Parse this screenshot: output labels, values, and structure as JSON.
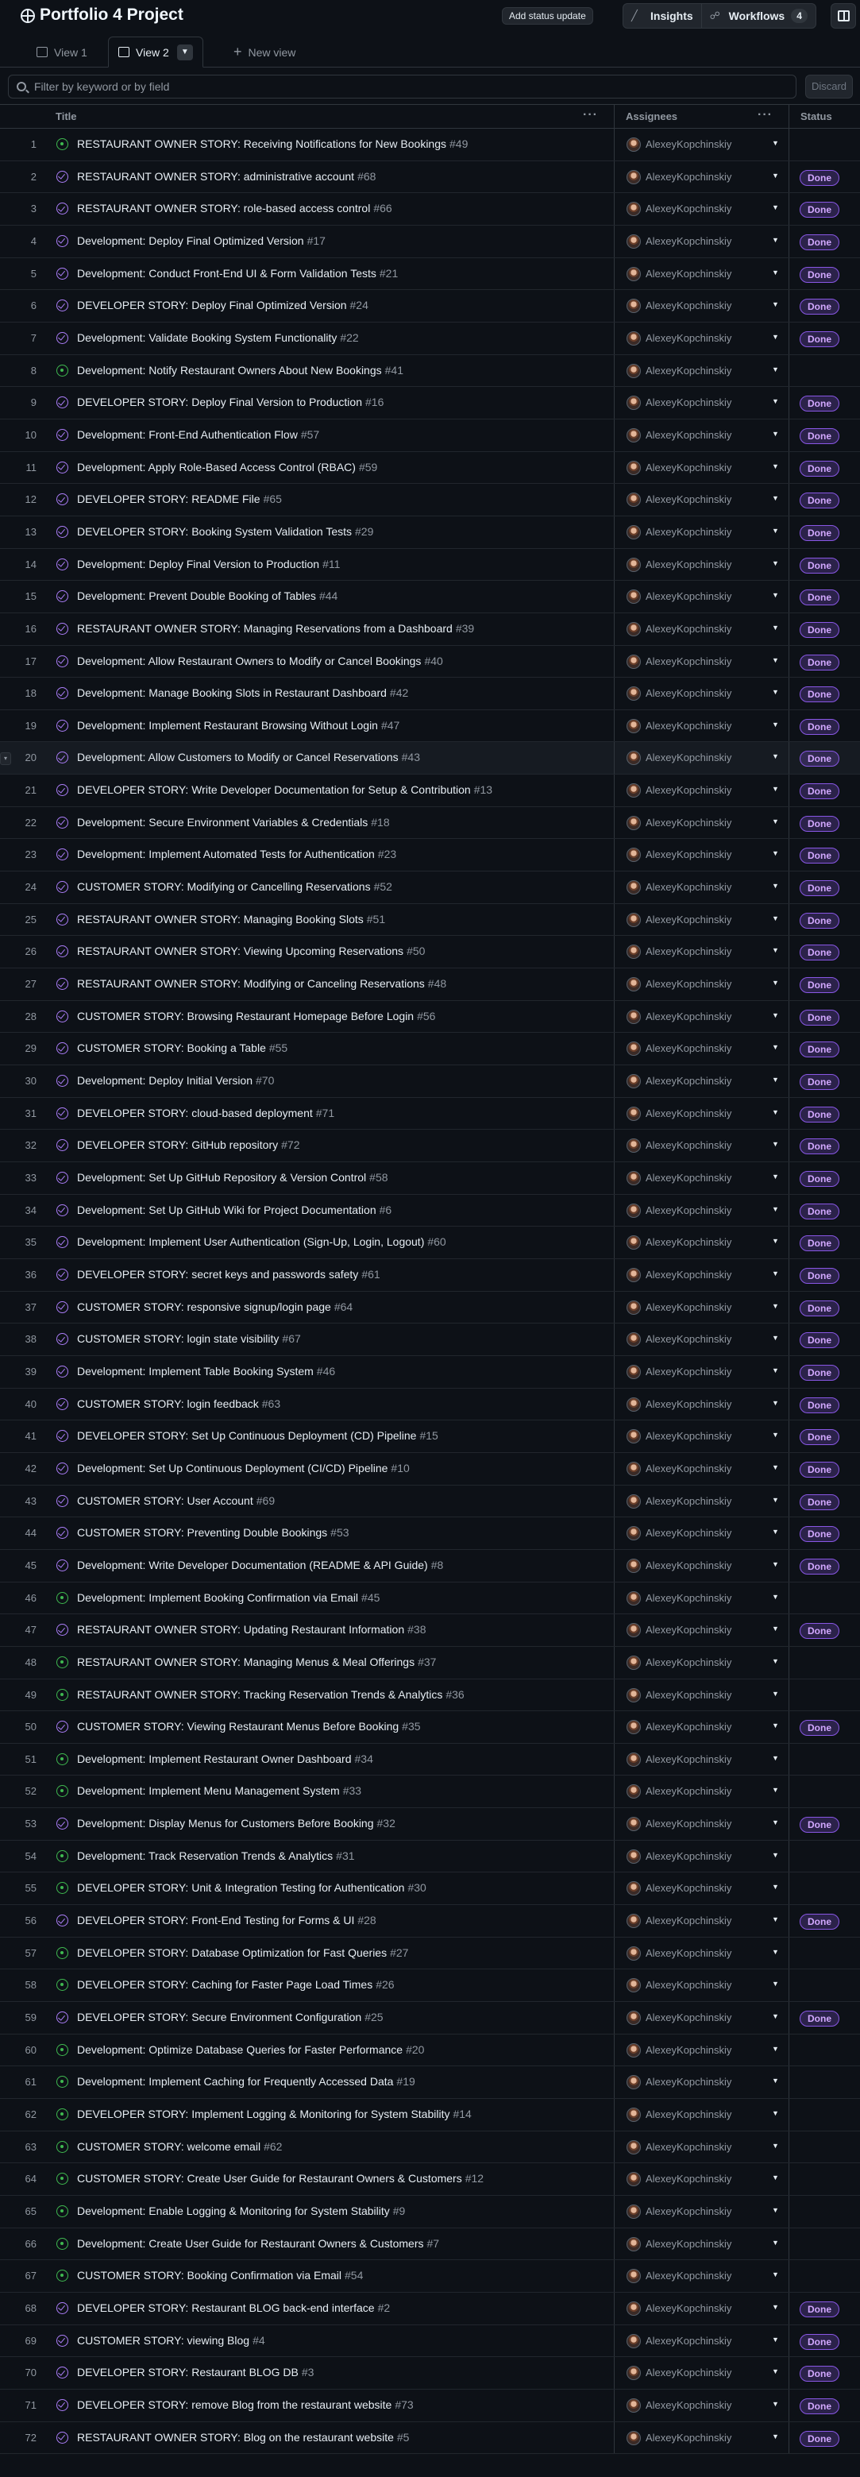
{
  "project": {
    "title": "Portfolio 4 Project"
  },
  "header": {
    "status_update_label": "Add status update",
    "insights_label": "Insights",
    "workflows_label": "Workflows",
    "workflows_count": "4"
  },
  "tabs": [
    {
      "label": "View 1"
    },
    {
      "label": "View 2"
    },
    {
      "label": "New view"
    }
  ],
  "filter": {
    "placeholder": "Filter by keyword or by field",
    "discard_label": "Discard"
  },
  "columns": {
    "title": "Title",
    "assignees": "Assignees",
    "status": "Status"
  },
  "rows": [
    {
      "n": "1",
      "state": "open",
      "title": "RESTAURANT OWNER STORY: Receiving Notifications for New Bookings",
      "num": "#49",
      "user": "AlexeyKopchinskiy",
      "status": ""
    },
    {
      "n": "2",
      "state": "closed",
      "title": "RESTAURANT OWNER STORY: administrative account",
      "num": "#68",
      "user": "AlexeyKopchinskiy",
      "status": "Done"
    },
    {
      "n": "3",
      "state": "closed",
      "title": "RESTAURANT OWNER STORY: role-based access control",
      "num": "#66",
      "user": "AlexeyKopchinskiy",
      "status": "Done"
    },
    {
      "n": "4",
      "state": "closed",
      "title": "Development: Deploy Final Optimized Version",
      "num": "#17",
      "user": "AlexeyKopchinskiy",
      "status": "Done"
    },
    {
      "n": "5",
      "state": "closed",
      "title": "Development: Conduct Front-End UI & Form Validation Tests",
      "num": "#21",
      "user": "AlexeyKopchinskiy",
      "status": "Done"
    },
    {
      "n": "6",
      "state": "closed",
      "title": "DEVELOPER STORY: Deploy Final Optimized Version",
      "num": "#24",
      "user": "AlexeyKopchinskiy",
      "status": "Done"
    },
    {
      "n": "7",
      "state": "closed",
      "title": "Development: Validate Booking System Functionality",
      "num": "#22",
      "user": "AlexeyKopchinskiy",
      "status": "Done"
    },
    {
      "n": "8",
      "state": "open",
      "title": "Development: Notify Restaurant Owners About New Bookings",
      "num": "#41",
      "user": "AlexeyKopchinskiy",
      "status": ""
    },
    {
      "n": "9",
      "state": "closed",
      "title": "DEVELOPER STORY: Deploy Final Version to Production",
      "num": "#16",
      "user": "AlexeyKopchinskiy",
      "status": "Done"
    },
    {
      "n": "10",
      "state": "closed",
      "title": "Development: Front-End Authentication Flow",
      "num": "#57",
      "user": "AlexeyKopchinskiy",
      "status": "Done"
    },
    {
      "n": "11",
      "state": "closed",
      "title": "Development: Apply Role-Based Access Control (RBAC)",
      "num": "#59",
      "user": "AlexeyKopchinskiy",
      "status": "Done"
    },
    {
      "n": "12",
      "state": "closed",
      "title": "DEVELOPER STORY: README File",
      "num": "#65",
      "user": "AlexeyKopchinskiy",
      "status": "Done"
    },
    {
      "n": "13",
      "state": "closed",
      "title": "DEVELOPER STORY: Booking System Validation Tests",
      "num": "#29",
      "user": "AlexeyKopchinskiy",
      "status": "Done"
    },
    {
      "n": "14",
      "state": "closed",
      "title": "Development: Deploy Final Version to Production",
      "num": "#11",
      "user": "AlexeyKopchinskiy",
      "status": "Done"
    },
    {
      "n": "15",
      "state": "closed",
      "title": "Development: Prevent Double Booking of Tables",
      "num": "#44",
      "user": "AlexeyKopchinskiy",
      "status": "Done"
    },
    {
      "n": "16",
      "state": "closed",
      "title": "RESTAURANT OWNER STORY: Managing Reservations from a Dashboard",
      "num": "#39",
      "user": "AlexeyKopchinskiy",
      "status": "Done"
    },
    {
      "n": "17",
      "state": "closed",
      "title": "Development: Allow Restaurant Owners to Modify or Cancel Bookings",
      "num": "#40",
      "user": "AlexeyKopchinskiy",
      "status": "Done"
    },
    {
      "n": "18",
      "state": "closed",
      "title": "Development: Manage Booking Slots in Restaurant Dashboard",
      "num": "#42",
      "user": "AlexeyKopchinskiy",
      "status": "Done"
    },
    {
      "n": "19",
      "state": "closed",
      "title": "Development: Implement Restaurant Browsing Without Login",
      "num": "#47",
      "user": "AlexeyKopchinskiy",
      "status": "Done"
    },
    {
      "n": "20",
      "state": "closed",
      "title": "Development: Allow Customers to Modify or Cancel Reservations",
      "num": "#43",
      "user": "AlexeyKopchinskiy",
      "status": "Done"
    },
    {
      "n": "21",
      "state": "closed",
      "title": "DEVELOPER STORY: Write Developer Documentation for Setup & Contribution",
      "num": "#13",
      "user": "AlexeyKopchinskiy",
      "status": "Done"
    },
    {
      "n": "22",
      "state": "closed",
      "title": "Development: Secure Environment Variables & Credentials",
      "num": "#18",
      "user": "AlexeyKopchinskiy",
      "status": "Done"
    },
    {
      "n": "23",
      "state": "closed",
      "title": "Development: Implement Automated Tests for Authentication",
      "num": "#23",
      "user": "AlexeyKopchinskiy",
      "status": "Done"
    },
    {
      "n": "24",
      "state": "closed",
      "title": "CUSTOMER STORY: Modifying or Cancelling Reservations",
      "num": "#52",
      "user": "AlexeyKopchinskiy",
      "status": "Done"
    },
    {
      "n": "25",
      "state": "closed",
      "title": "RESTAURANT OWNER STORY: Managing Booking Slots",
      "num": "#51",
      "user": "AlexeyKopchinskiy",
      "status": "Done"
    },
    {
      "n": "26",
      "state": "closed",
      "title": "RESTAURANT OWNER STORY: Viewing Upcoming Reservations",
      "num": "#50",
      "user": "AlexeyKopchinskiy",
      "status": "Done"
    },
    {
      "n": "27",
      "state": "closed",
      "title": "RESTAURANT OWNER STORY: Modifying or Canceling Reservations",
      "num": "#48",
      "user": "AlexeyKopchinskiy",
      "status": "Done"
    },
    {
      "n": "28",
      "state": "closed",
      "title": "CUSTOMER STORY: Browsing Restaurant Homepage Before Login",
      "num": "#56",
      "user": "AlexeyKopchinskiy",
      "status": "Done"
    },
    {
      "n": "29",
      "state": "closed",
      "title": "CUSTOMER STORY: Booking a Table",
      "num": "#55",
      "user": "AlexeyKopchinskiy",
      "status": "Done"
    },
    {
      "n": "30",
      "state": "closed",
      "title": "Development: Deploy Initial Version",
      "num": "#70",
      "user": "AlexeyKopchinskiy",
      "status": "Done"
    },
    {
      "n": "31",
      "state": "closed",
      "title": "DEVELOPER STORY: cloud-based deployment",
      "num": "#71",
      "user": "AlexeyKopchinskiy",
      "status": "Done"
    },
    {
      "n": "32",
      "state": "closed",
      "title": "DEVELOPER STORY: GitHub repository",
      "num": "#72",
      "user": "AlexeyKopchinskiy",
      "status": "Done"
    },
    {
      "n": "33",
      "state": "closed",
      "title": "Development: Set Up GitHub Repository & Version Control",
      "num": "#58",
      "user": "AlexeyKopchinskiy",
      "status": "Done"
    },
    {
      "n": "34",
      "state": "closed",
      "title": "Development: Set Up GitHub Wiki for Project Documentation",
      "num": "#6",
      "user": "AlexeyKopchinskiy",
      "status": "Done"
    },
    {
      "n": "35",
      "state": "closed",
      "title": "Development: Implement User Authentication (Sign-Up, Login, Logout)",
      "num": "#60",
      "user": "AlexeyKopchinskiy",
      "status": "Done"
    },
    {
      "n": "36",
      "state": "closed",
      "title": "DEVELOPER STORY: secret keys and passwords safety",
      "num": "#61",
      "user": "AlexeyKopchinskiy",
      "status": "Done"
    },
    {
      "n": "37",
      "state": "closed",
      "title": "CUSTOMER STORY: responsive signup/login page",
      "num": "#64",
      "user": "AlexeyKopchinskiy",
      "status": "Done"
    },
    {
      "n": "38",
      "state": "closed",
      "title": "CUSTOMER STORY: login state visibility",
      "num": "#67",
      "user": "AlexeyKopchinskiy",
      "status": "Done"
    },
    {
      "n": "39",
      "state": "closed",
      "title": "Development: Implement Table Booking System",
      "num": "#46",
      "user": "AlexeyKopchinskiy",
      "status": "Done"
    },
    {
      "n": "40",
      "state": "closed",
      "title": "CUSTOMER STORY: login feedback",
      "num": "#63",
      "user": "AlexeyKopchinskiy",
      "status": "Done"
    },
    {
      "n": "41",
      "state": "closed",
      "title": "DEVELOPER STORY: Set Up Continuous Deployment (CD) Pipeline",
      "num": "#15",
      "user": "AlexeyKopchinskiy",
      "status": "Done"
    },
    {
      "n": "42",
      "state": "closed",
      "title": "Development: Set Up Continuous Deployment (CI/CD) Pipeline",
      "num": "#10",
      "user": "AlexeyKopchinskiy",
      "status": "Done"
    },
    {
      "n": "43",
      "state": "closed",
      "title": "CUSTOMER STORY: User Account",
      "num": "#69",
      "user": "AlexeyKopchinskiy",
      "status": "Done"
    },
    {
      "n": "44",
      "state": "closed",
      "title": "CUSTOMER STORY: Preventing Double Bookings",
      "num": "#53",
      "user": "AlexeyKopchinskiy",
      "status": "Done"
    },
    {
      "n": "45",
      "state": "closed",
      "title": "Development: Write Developer Documentation (README & API Guide)",
      "num": "#8",
      "user": "AlexeyKopchinskiy",
      "status": "Done"
    },
    {
      "n": "46",
      "state": "open",
      "title": "Development: Implement Booking Confirmation via Email",
      "num": "#45",
      "user": "AlexeyKopchinskiy",
      "status": ""
    },
    {
      "n": "47",
      "state": "closed",
      "title": "RESTAURANT OWNER STORY: Updating Restaurant Information",
      "num": "#38",
      "user": "AlexeyKopchinskiy",
      "status": "Done"
    },
    {
      "n": "48",
      "state": "open",
      "title": "RESTAURANT OWNER STORY: Managing Menus & Meal Offerings",
      "num": "#37",
      "user": "AlexeyKopchinskiy",
      "status": ""
    },
    {
      "n": "49",
      "state": "open",
      "title": "RESTAURANT OWNER STORY: Tracking Reservation Trends & Analytics",
      "num": "#36",
      "user": "AlexeyKopchinskiy",
      "status": ""
    },
    {
      "n": "50",
      "state": "closed",
      "title": "CUSTOMER STORY: Viewing Restaurant Menus Before Booking",
      "num": "#35",
      "user": "AlexeyKopchinskiy",
      "status": "Done"
    },
    {
      "n": "51",
      "state": "open",
      "title": "Development: Implement Restaurant Owner Dashboard",
      "num": "#34",
      "user": "AlexeyKopchinskiy",
      "status": ""
    },
    {
      "n": "52",
      "state": "open",
      "title": "Development: Implement Menu Management System",
      "num": "#33",
      "user": "AlexeyKopchinskiy",
      "status": ""
    },
    {
      "n": "53",
      "state": "closed",
      "title": "Development: Display Menus for Customers Before Booking",
      "num": "#32",
      "user": "AlexeyKopchinskiy",
      "status": "Done"
    },
    {
      "n": "54",
      "state": "open",
      "title": "Development: Track Reservation Trends & Analytics",
      "num": "#31",
      "user": "AlexeyKopchinskiy",
      "status": ""
    },
    {
      "n": "55",
      "state": "open",
      "title": "DEVELOPER STORY: Unit & Integration Testing for Authentication",
      "num": "#30",
      "user": "AlexeyKopchinskiy",
      "status": ""
    },
    {
      "n": "56",
      "state": "closed",
      "title": "DEVELOPER STORY: Front-End Testing for Forms & UI",
      "num": "#28",
      "user": "AlexeyKopchinskiy",
      "status": "Done"
    },
    {
      "n": "57",
      "state": "open",
      "title": "DEVELOPER STORY: Database Optimization for Fast Queries",
      "num": "#27",
      "user": "AlexeyKopchinskiy",
      "status": ""
    },
    {
      "n": "58",
      "state": "open",
      "title": "DEVELOPER STORY: Caching for Faster Page Load Times",
      "num": "#26",
      "user": "AlexeyKopchinskiy",
      "status": ""
    },
    {
      "n": "59",
      "state": "closed",
      "title": "DEVELOPER STORY: Secure Environment Configuration",
      "num": "#25",
      "user": "AlexeyKopchinskiy",
      "status": "Done"
    },
    {
      "n": "60",
      "state": "open",
      "title": "Development: Optimize Database Queries for Faster Performance",
      "num": "#20",
      "user": "AlexeyKopchinskiy",
      "status": ""
    },
    {
      "n": "61",
      "state": "open",
      "title": "Development: Implement Caching for Frequently Accessed Data",
      "num": "#19",
      "user": "AlexeyKopchinskiy",
      "status": ""
    },
    {
      "n": "62",
      "state": "open",
      "title": "DEVELOPER STORY: Implement Logging & Monitoring for System Stability",
      "num": "#14",
      "user": "AlexeyKopchinskiy",
      "status": ""
    },
    {
      "n": "63",
      "state": "open",
      "title": "CUSTOMER STORY: welcome email",
      "num": "#62",
      "user": "AlexeyKopchinskiy",
      "status": ""
    },
    {
      "n": "64",
      "state": "open",
      "title": "CUSTOMER STORY: Create User Guide for Restaurant Owners & Customers",
      "num": "#12",
      "user": "AlexeyKopchinskiy",
      "status": ""
    },
    {
      "n": "65",
      "state": "open",
      "title": "Development: Enable Logging & Monitoring for System Stability",
      "num": "#9",
      "user": "AlexeyKopchinskiy",
      "status": ""
    },
    {
      "n": "66",
      "state": "open",
      "title": "Development: Create User Guide for Restaurant Owners & Customers",
      "num": "#7",
      "user": "AlexeyKopchinskiy",
      "status": ""
    },
    {
      "n": "67",
      "state": "open",
      "title": "CUSTOMER STORY: Booking Confirmation via Email",
      "num": "#54",
      "user": "AlexeyKopchinskiy",
      "status": ""
    },
    {
      "n": "68",
      "state": "closed",
      "title": "DEVELOPER STORY: Restaurant BLOG back-end interface",
      "num": "#2",
      "user": "AlexeyKopchinskiy",
      "status": "Done"
    },
    {
      "n": "69",
      "state": "closed",
      "title": "CUSTOMER STORY: viewing Blog",
      "num": "#4",
      "user": "AlexeyKopchinskiy",
      "status": "Done"
    },
    {
      "n": "70",
      "state": "closed",
      "title": "DEVELOPER STORY: Restaurant BLOG DB",
      "num": "#3",
      "user": "AlexeyKopchinskiy",
      "status": "Done"
    },
    {
      "n": "71",
      "state": "closed",
      "title": "DEVELOPER STORY: remove Blog from the restaurant website",
      "num": "#73",
      "user": "AlexeyKopchinskiy",
      "status": "Done"
    },
    {
      "n": "72",
      "state": "closed",
      "title": "RESTAURANT OWNER STORY: Blog on the restaurant website",
      "num": "#5",
      "user": "AlexeyKopchinskiy",
      "status": "Done"
    }
  ],
  "colors": {
    "accent_done": "#8957e5",
    "closed_icon": "#ab7df8",
    "open_icon": "#3fb950"
  }
}
